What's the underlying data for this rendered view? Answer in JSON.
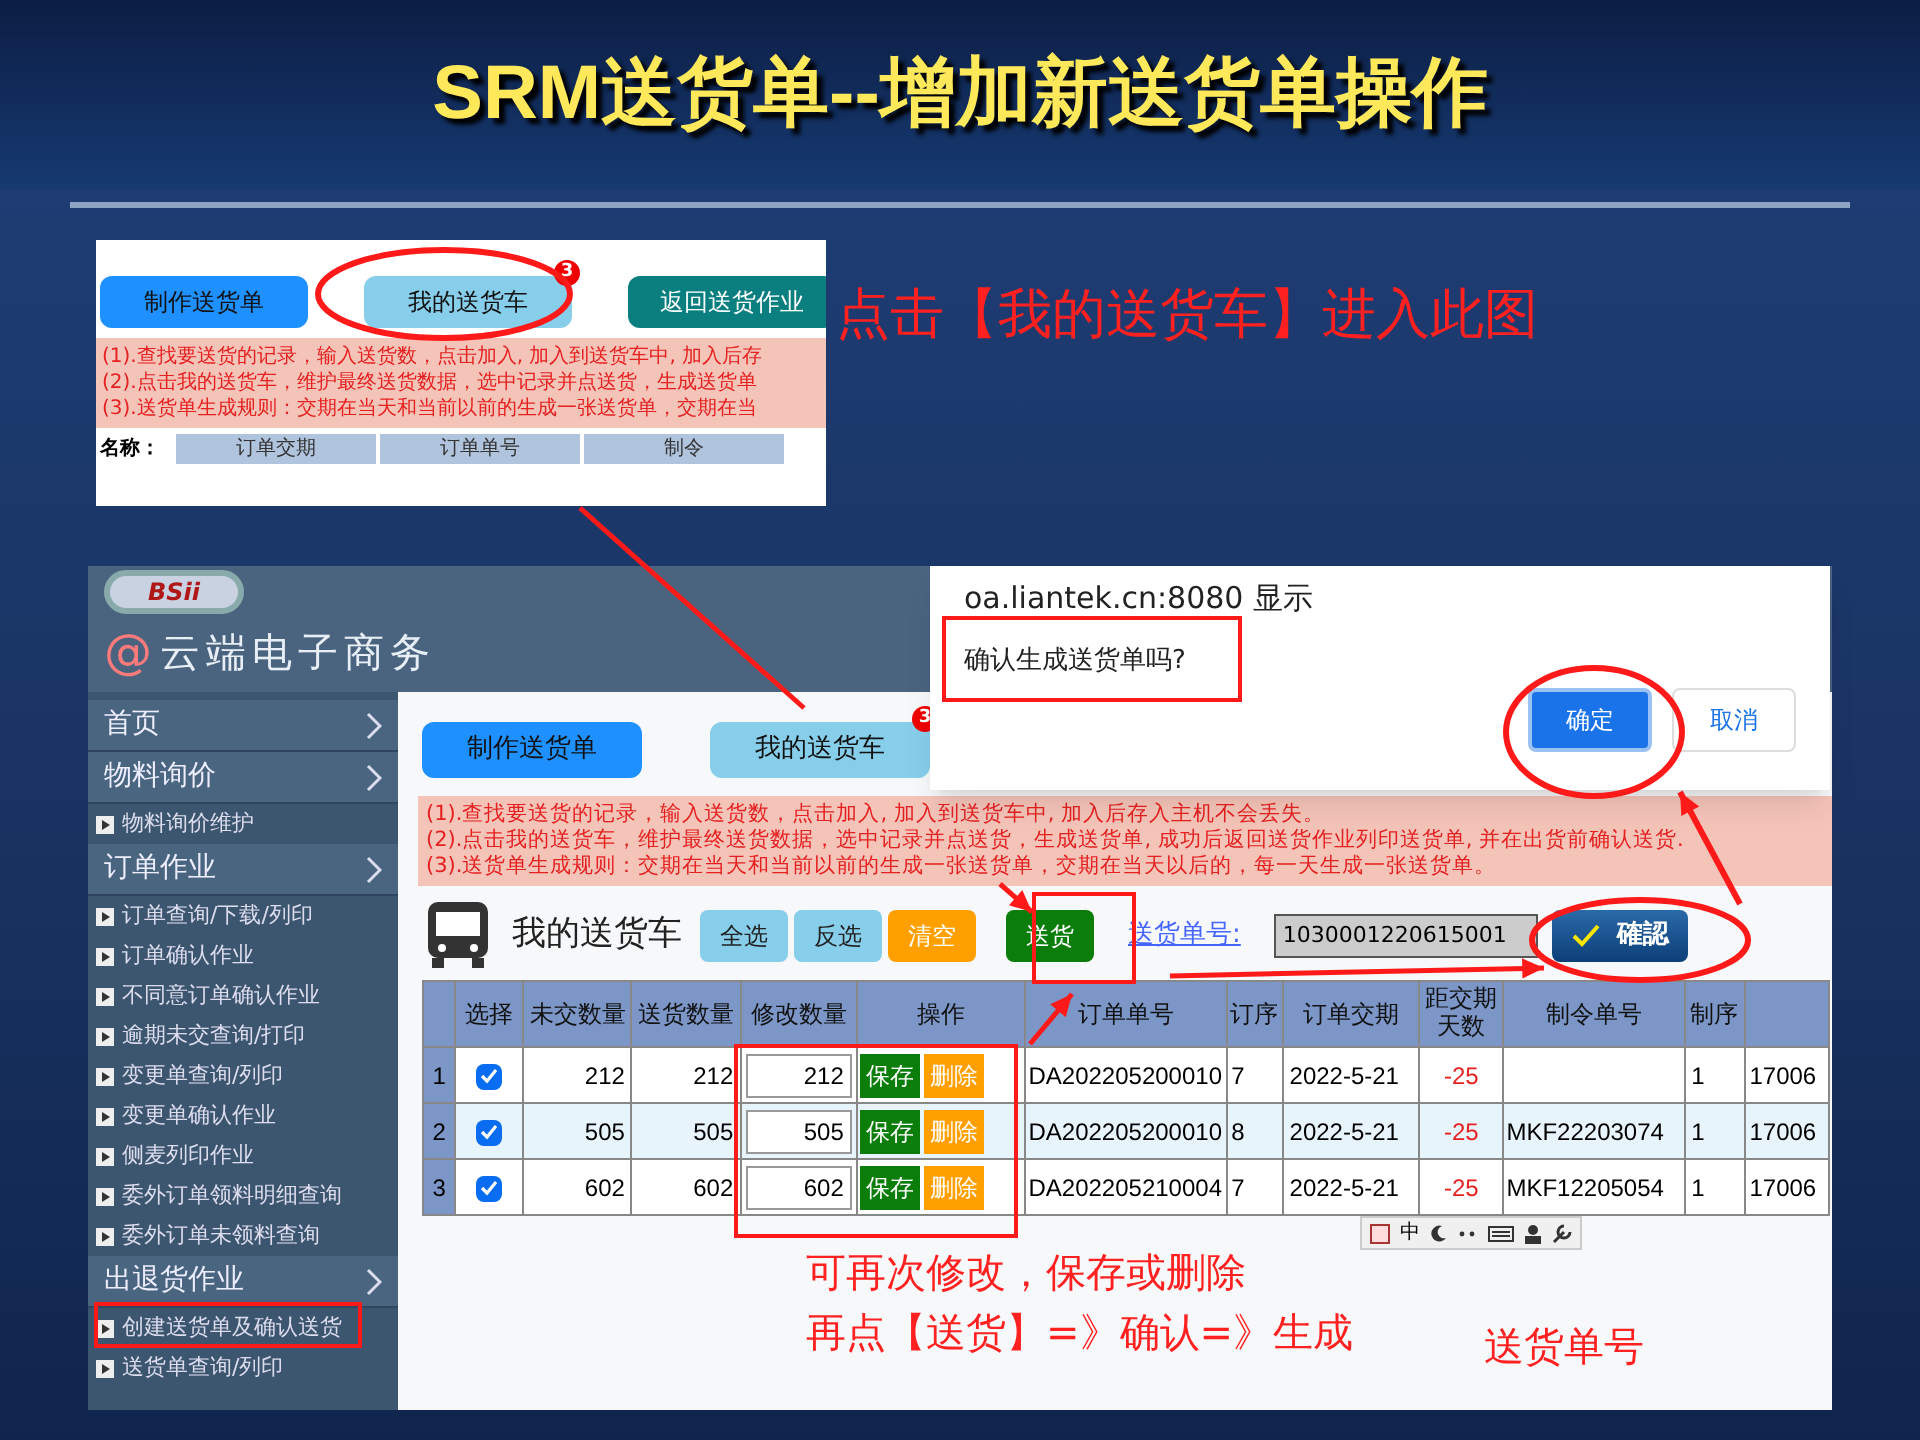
{
  "slide_title": "SRM送货单--增加新送货单操作",
  "preview": {
    "tabs": [
      {
        "label": "制作送货单",
        "color": "#1e90ff"
      },
      {
        "label": "我的送货车",
        "color": "#87ceeb"
      },
      {
        "label": "返回送货作业",
        "color": "#0b7f7f"
      }
    ],
    "badge": "3",
    "notes": [
      "(1).查找要送货的记录，输入送货数，点击加入, 加入到送货车中, 加入后存",
      "(2).点击我的送货车，维护最终送货数据，选中记录并点送货，生成送货单",
      "(3).送货单生成规则：交期在当天和当前以前的生成一张送货单，交期在当"
    ],
    "label": "名称：",
    "columns": [
      "订单交期",
      "订单单号",
      "制令"
    ]
  },
  "callout": "点击【我的送货车】进入此图",
  "app": {
    "logo": "BSii",
    "at_sign": "@",
    "brand": "云端电子商务",
    "sidebar": [
      {
        "label": "首页"
      },
      {
        "label": "物料询价",
        "children": [
          {
            "label": "物料询价维护"
          }
        ]
      },
      {
        "label": "订单作业",
        "children": [
          {
            "label": "订单查询/下载/列印"
          },
          {
            "label": "订单确认作业"
          },
          {
            "label": "不同意订单确认作业"
          },
          {
            "label": "逾期未交查询/打印"
          },
          {
            "label": "变更单查询/列印"
          },
          {
            "label": "变更单确认作业"
          },
          {
            "label": "侧麦列印作业"
          },
          {
            "label": "委外订单领料明细查询"
          },
          {
            "label": "委外订单未领料查询"
          }
        ]
      },
      {
        "label": "出退货作业",
        "children": [
          {
            "label": "创建送货单及确认送货"
          },
          {
            "label": "送货单查询/列印"
          }
        ]
      }
    ],
    "tabs": [
      {
        "label": "制作送货单",
        "color": "#1e90ff"
      },
      {
        "label": "我的送货车",
        "color": "#87ceeb"
      }
    ],
    "badge": "3",
    "notes": [
      "(1).查找要送货的记录，输入送货数，点击加入, 加入到送货车中, 加入后存入主机不会丢失。",
      "(2).点击我的送货车，维护最终送货数据，选中记录并点送货，生成送货单, 成功后返回送货作业列印送货单, 并在出货前确认送货.",
      "(3).送货单生成规则：交期在当天和当前以前的生成一张送货单，交期在当天以后的，每一天生成一张送货单。"
    ],
    "cart_title": "我的送货车",
    "actions": [
      {
        "label": "全选",
        "color": "#87ceeb"
      },
      {
        "label": "反选",
        "color": "#87ceeb"
      },
      {
        "label": "清空",
        "color": "#ff9f00"
      },
      {
        "label": "送货",
        "color": "#0a7d0a"
      }
    ],
    "order_no_label": "送货单号:",
    "order_no": "1030001220615001",
    "confirm_button": "確認",
    "columns": [
      "",
      "选择",
      "未交数量",
      "送货数量",
      "修改数量",
      "操作",
      "订单单号",
      "订序",
      "订单交期",
      "距交期天数",
      "制令单号",
      "制序",
      ""
    ],
    "rows": [
      {
        "index": "1",
        "checked": true,
        "open_qty": "212",
        "send_qty": "212",
        "edit_qty": "212",
        "save": "保存",
        "delete": "删除",
        "order_no": "DA202205200010",
        "seq": "7",
        "due": "2022-5-21",
        "days": "-25",
        "mo_no": "",
        "mo_seq": "1",
        "column_13": "17006"
      },
      {
        "index": "2",
        "checked": true,
        "open_qty": "505",
        "send_qty": "505",
        "edit_qty": "505",
        "save": "保存",
        "delete": "删除",
        "order_no": "DA202205200010",
        "seq": "8",
        "due": "2022-5-21",
        "days": "-25",
        "mo_no": "MKF22203074",
        "mo_seq": "1",
        "column_13": "17006"
      },
      {
        "index": "3",
        "checked": true,
        "open_qty": "602",
        "send_qty": "602",
        "edit_qty": "602",
        "save": "保存",
        "delete": "删除",
        "order_no": "DA202205210004",
        "seq": "7",
        "due": "2022-5-21",
        "days": "-25",
        "mo_no": "MKF12205054",
        "mo_seq": "1",
        "column_13": "17006"
      }
    ],
    "ime": "中"
  },
  "dialog": {
    "title": "oa.liantek.cn:8080 显示",
    "message": "确认生成送货单吗?",
    "buttons": [
      {
        "label": "确定",
        "kind": "primary"
      },
      {
        "label": "取消",
        "kind": "secondary"
      }
    ]
  },
  "bottom_notes": [
    "可再次修改，保存或删除",
    "再点【送货】=》确认=》生成"
  ],
  "side_note": "送货单号"
}
